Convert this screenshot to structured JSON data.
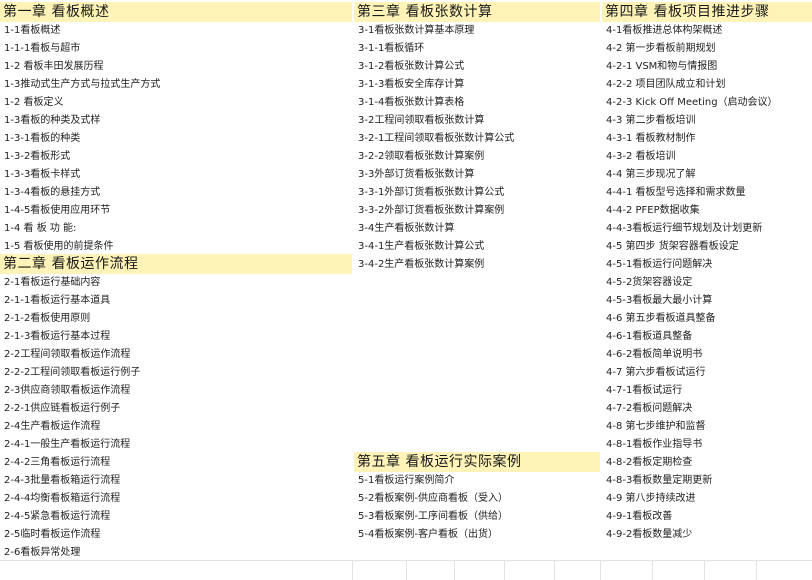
{
  "chapters": {
    "ch1": {
      "title": "第一章  看板概述",
      "items": [
        "1-1看板概述",
        "1-1-1看板与超市",
        "1-2 看板丰田发展历程",
        "1-3推动式生产方式与拉式生产方式",
        "1-2 看板定义",
        "1-3看板的种类及式样",
        "1-3-1看板的种类",
        "1-3-2看板形式",
        "1-3-3看板卡样式",
        "1-3-4看板的悬挂方式",
        "1-4-5看板使用应用环节",
        "1-4  看  板  功  能:",
        "1-5 看板使用的前提条件"
      ]
    },
    "ch2": {
      "title": "第二章  看板运作流程",
      "items": [
        "2-1看板运行基础内容",
        "2-1-1看板运行基本道具",
        "2-1-2看板使用原则",
        "2-1-3看板运行基本过程",
        "2-2工程间领取看板运作流程",
        "2-2-2工程间领取看板运行例子",
        "2-3供应商领取看板运作流程",
        "2-2-1供应链看板运行例子",
        "2-4生产看板运作流程",
        "2-4-1一般生产看板运行流程",
        "2-4-2三角看板运行流程",
        "2-4-3批量看板箱运行流程",
        "2-4-4均衡看板箱运行流程",
        "2-4-5紧急看板运行流程",
        "2-5临时看板运作流程",
        "2-6看板异常处理"
      ]
    },
    "ch3": {
      "title": "第三章  看板张数计算",
      "items": [
        "3-1看板张数计算基本原理",
        "3-1-1看板循环",
        "3-1-2看板张数计算公式",
        "3-1-3看板安全库存计算",
        "3-1-4看板张数计算表格",
        "3-2工程间领取看板张数计算",
        "3-2-1工程间领取看板张数计算公式",
        "3-2-2领取看板张数计算案例",
        "3-3外部订货看板张数计算",
        "3-3-1外部订货看板张数计算公式",
        "3-3-2外部订货看板张数计算案例",
        "3-4生产看板张数计算",
        "3-4-1生产看板张数计算公式",
        "3-4-2生产看板张数计算案例"
      ]
    },
    "ch4": {
      "title": "第四章  看板项目推进步骤",
      "items": [
        "4-1看板推进总体构架概述",
        "4-2 第一步看板前期规划",
        "4-2-1 VSM和物与情报图",
        "4-2-2 项目团队成立和计划",
        "4-2-3 Kick Off Meeting（启动会议）",
        "4-3 第二步看板培训",
        "4-3-1 看板教材制作",
        "4-3-2 看板培训",
        "4-4 第三步现况了解",
        "4-4-1 看板型号选择和需求数量",
        "4-4-2 PFEP数据收集",
        "4-4-3看板运行细节规划及计划更新",
        "4-5 第四步 货架容器看板设定",
        "4-5-1看板运行问题解决",
        "4-5-2货架容器设定",
        "4-5-3看板最大最小计算",
        "4-6 第五步看板道具整备",
        "4-6-1看板道具整备",
        "4-6-2看板简单说明书",
        "4-7 第六步看板试运行",
        "4-7-1看板试运行",
        "4-7-2看板问题解决",
        "4-8 第七步维护和监督",
        "4-8-1看板作业指导书",
        "4-8-2看板定期检查",
        "4-8-3看板数量定期更新",
        "4-9 第八步持续改进",
        "4-9-1看板改善",
        "4-9-2看板数量减少"
      ]
    },
    "ch5": {
      "title": "第五章  看板运行实际案例",
      "items": [
        "5-1看板运行案例简介",
        "5-2看板案例-供应商看板（受入）",
        "5-3看板案例-工序间看板（供给）",
        "5-4看板案例-客户看板（出货）"
      ]
    }
  }
}
